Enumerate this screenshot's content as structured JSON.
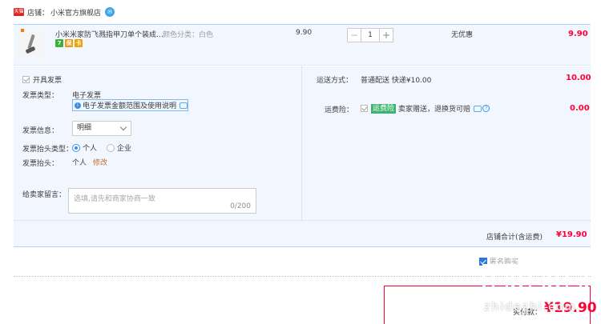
{
  "shop": {
    "logo_text": "天猫",
    "label": "店铺：",
    "name": "小米官方旗舰店",
    "chat_icon": "chat-bubble-icon"
  },
  "item": {
    "title": "小米米家防飞溅指甲刀单个装成…",
    "sku": "颜色分类：白色",
    "price": "9.90",
    "quantity": "1",
    "minus": "−",
    "plus": "+",
    "discount": "无优惠",
    "total": "9.90",
    "badges": [
      "7",
      "保",
      "卡"
    ]
  },
  "invoice": {
    "enable_label": "开具发票",
    "type_label": "发票类型：",
    "type_value": "电子发票",
    "tip": "电子发票金额范围及使用说明",
    "info_label": "发票信息：",
    "info_value": "明细",
    "title_type_label": "发票抬头类型：",
    "option_personal": "个人",
    "option_company": "企业",
    "title_label": "发票抬头：",
    "title_value": "个人",
    "modify": "修改"
  },
  "message": {
    "label": "给卖家留言：",
    "placeholder": "选填,请先和商家协商一致",
    "count": "0/200"
  },
  "delivery": {
    "label": "运送方式：",
    "value": "普通配送 快递¥10.00",
    "fee": "10.00"
  },
  "insurance": {
    "label": "运费险：",
    "badge": "运费险",
    "text": "卖家赠送，退换货可赔",
    "fee": "0.00"
  },
  "store_total": {
    "label": "店铺合计(含运费)",
    "value": "¥19.90"
  },
  "anonymous": {
    "label": "匿名购买"
  },
  "payment": {
    "label": "实付款：",
    "value": "¥19.90"
  },
  "watermark": {
    "text": "zhidezhi.com"
  },
  "colors": {
    "accent_red": "#ff0036",
    "panel_blue": "#f2f7ff",
    "link_orange": "#c56a2b"
  }
}
